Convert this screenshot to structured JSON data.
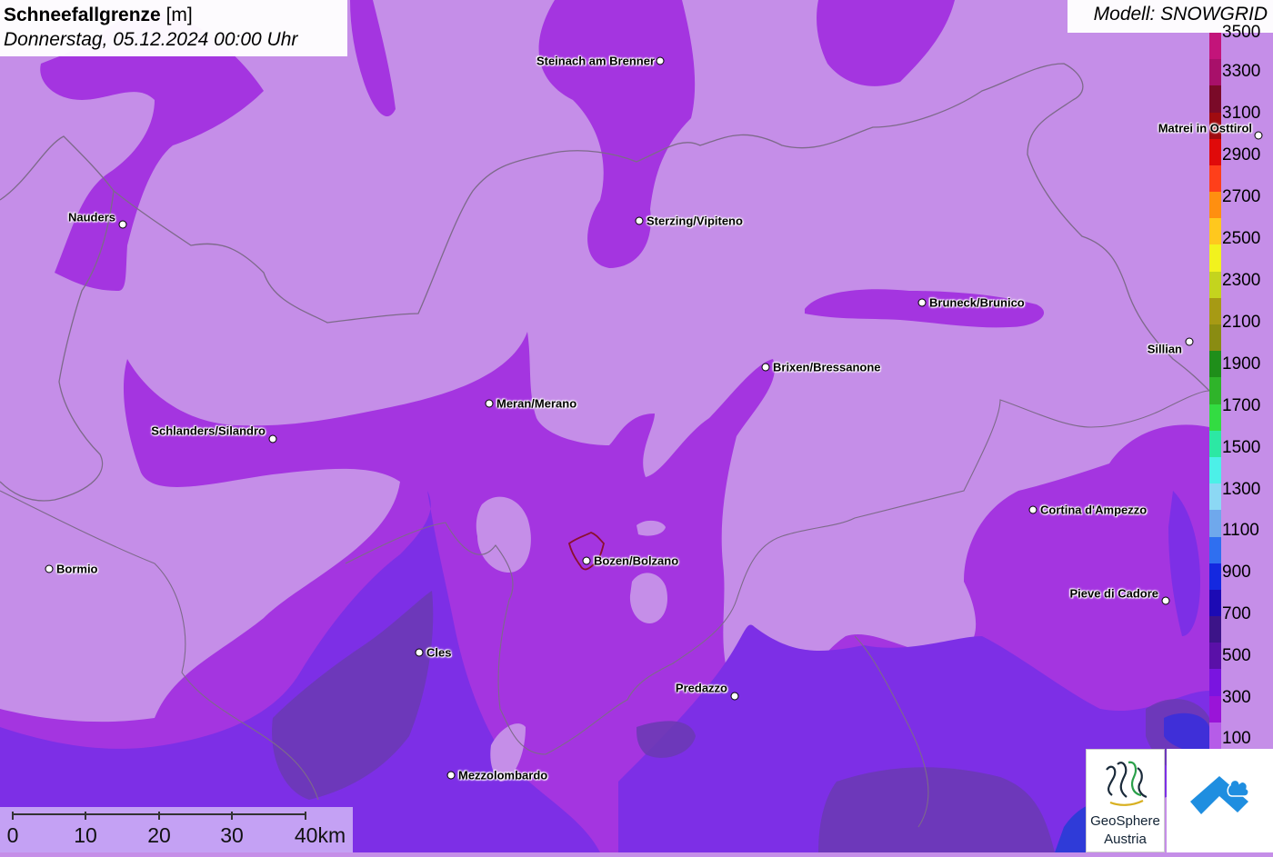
{
  "title": {
    "bold": "Schneefallgrenze",
    "unit": "[m]",
    "date": "Donnerstag, 05.12.2024 00:00 Uhr"
  },
  "model": "Modell: SNOWGRID",
  "legend": {
    "labels": [
      "3500",
      "3300",
      "3100",
      "2900",
      "2700",
      "2500",
      "2300",
      "2100",
      "1900",
      "1700",
      "1500",
      "1300",
      "1100",
      "900",
      "700",
      "500",
      "300",
      "100"
    ],
    "colors": [
      "#c3147a",
      "#a8106a",
      "#7a0a28",
      "#a00b10",
      "#e00a0a",
      "#ff3f1a",
      "#ff8f10",
      "#ffc81e",
      "#f2f21e",
      "#c4d41e",
      "#a79a14",
      "#8a8c12",
      "#1f8e1a",
      "#2fb42a",
      "#33dc42",
      "#2ce8a4",
      "#4cf0e8",
      "#8cd8f4",
      "#6fa8ec",
      "#2f6ff0",
      "#1428e0",
      "#1c0ab4",
      "#3c1488",
      "#5a10a8",
      "#7a14e0",
      "#9a14d8",
      "#b65ce8"
    ]
  },
  "cities": [
    {
      "name": "Steinach am Brenner",
      "side": "left"
    },
    {
      "name": "Matrei in Osttirol",
      "side": "left"
    },
    {
      "name": "Nauders",
      "side": "left"
    },
    {
      "name": "Sterzing/Vipiteno",
      "side": "right"
    },
    {
      "name": "Bruneck/Brunico",
      "side": "right"
    },
    {
      "name": "Sillian",
      "side": "left"
    },
    {
      "name": "Brixen/Bressanone",
      "side": "right"
    },
    {
      "name": "Meran/Merano",
      "side": "right"
    },
    {
      "name": "Schlanders/Silandro",
      "side": "left"
    },
    {
      "name": "Cortina d'Ampezzo",
      "side": "right"
    },
    {
      "name": "Bormio",
      "side": "right"
    },
    {
      "name": "Bozen/Bolzano",
      "side": "right"
    },
    {
      "name": "Pieve di Cadore",
      "side": "left"
    },
    {
      "name": "Cles",
      "side": "right"
    },
    {
      "name": "Predazzo",
      "side": "left"
    },
    {
      "name": "Mezzolombardo",
      "side": "right"
    }
  ],
  "scale": {
    "labels": [
      "0",
      "10",
      "20",
      "30",
      "40km"
    ]
  },
  "logos": {
    "geosphere_line1": "GeoSphere",
    "geosphere_line2": "Austria"
  },
  "colors": {
    "light_zone": "#c58ee8",
    "mid_zone": "#a435e0",
    "dark_zone": "#7d2fe6",
    "deep_zone": "#6a3ab2"
  }
}
